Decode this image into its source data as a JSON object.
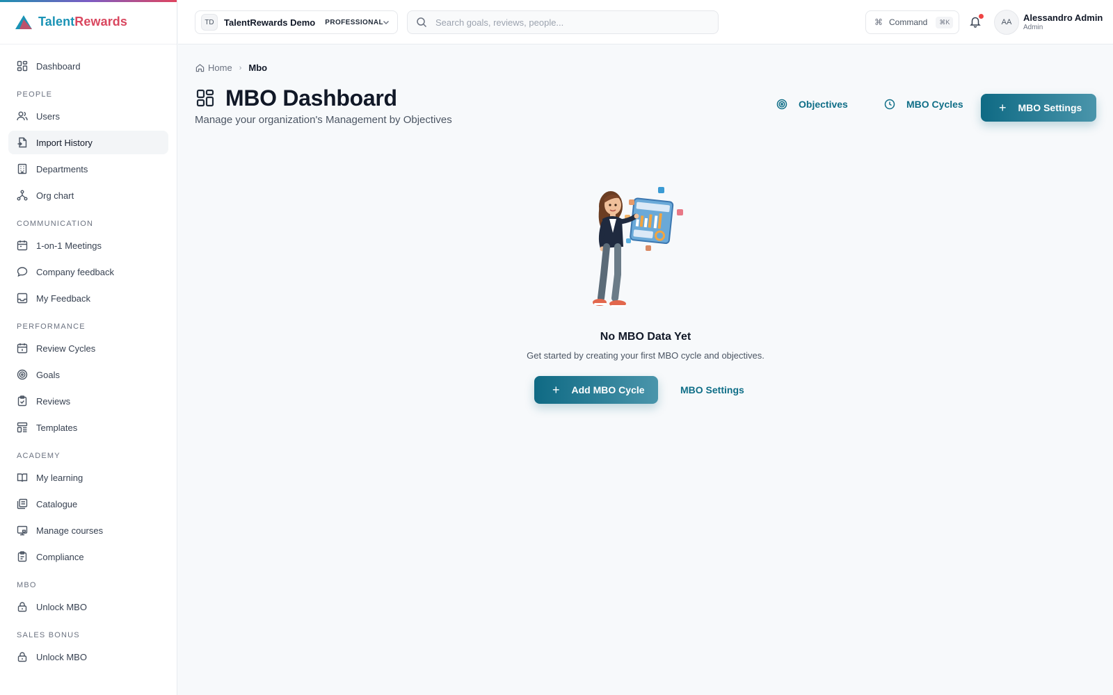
{
  "brand": {
    "name_part1": "Talent",
    "name_part2": "Rewards",
    "logo_icon": "triangle-logo-icon"
  },
  "sidebar": {
    "items": [
      {
        "label": "Dashboard",
        "icon": "dashboard-icon"
      }
    ],
    "sections": [
      {
        "title": "PEOPLE",
        "items": [
          {
            "label": "Users",
            "icon": "users-icon"
          },
          {
            "label": "Import History",
            "icon": "file-import-icon",
            "active": true
          },
          {
            "label": "Departments",
            "icon": "building-icon"
          },
          {
            "label": "Org chart",
            "icon": "org-chart-icon"
          }
        ]
      },
      {
        "title": "COMMUNICATION",
        "items": [
          {
            "label": "1-on-1 Meetings",
            "icon": "calendar-icon"
          },
          {
            "label": "Company feedback",
            "icon": "chat-bubble-icon"
          },
          {
            "label": "My Feedback",
            "icon": "inbox-icon"
          }
        ]
      },
      {
        "title": "PERFORMANCE",
        "items": [
          {
            "label": "Review Cycles",
            "icon": "calendar-check-icon"
          },
          {
            "label": "Goals",
            "icon": "target-icon"
          },
          {
            "label": "Reviews",
            "icon": "clipboard-check-icon"
          },
          {
            "label": "Templates",
            "icon": "template-icon"
          }
        ]
      },
      {
        "title": "ACADEMY",
        "items": [
          {
            "label": "My learning",
            "icon": "book-open-icon"
          },
          {
            "label": "Catalogue",
            "icon": "library-icon"
          },
          {
            "label": "Manage courses",
            "icon": "screen-icon"
          },
          {
            "label": "Compliance",
            "icon": "clipboard-icon"
          }
        ]
      },
      {
        "title": "MBO",
        "items": [
          {
            "label": "Unlock MBO",
            "icon": "lock-icon"
          }
        ]
      },
      {
        "title": "SALES BONUS",
        "items": [
          {
            "label": "Unlock MBO",
            "icon": "lock-icon"
          }
        ]
      }
    ]
  },
  "topbar": {
    "org_initials": "TD",
    "org_name": "TalentRewards Demo",
    "plan": "PROFESSIONAL",
    "search_placeholder": "Search goals, reviews, people...",
    "command_label": "Command",
    "command_shortcut": "⌘K",
    "user_initials": "AA",
    "user_name": "Alessandro Admin",
    "user_role": "Admin"
  },
  "breadcrumb": {
    "home": "Home",
    "current": "Mbo"
  },
  "page": {
    "title": "MBO Dashboard",
    "subtitle": "Manage your organization's Management by Objectives",
    "actions": {
      "objectives": "Objectives",
      "cycles": "MBO Cycles",
      "settings": "MBO Settings"
    }
  },
  "empty_state": {
    "title": "No MBO Data Yet",
    "description": "Get started by creating your first MBO cycle and objectives.",
    "add_button": "Add MBO Cycle",
    "settings_link": "MBO Settings"
  },
  "colors": {
    "accent": "#0f6e87",
    "brand_blue": "#1a93b5",
    "brand_red": "#d9475f",
    "notification": "#ef4444"
  }
}
